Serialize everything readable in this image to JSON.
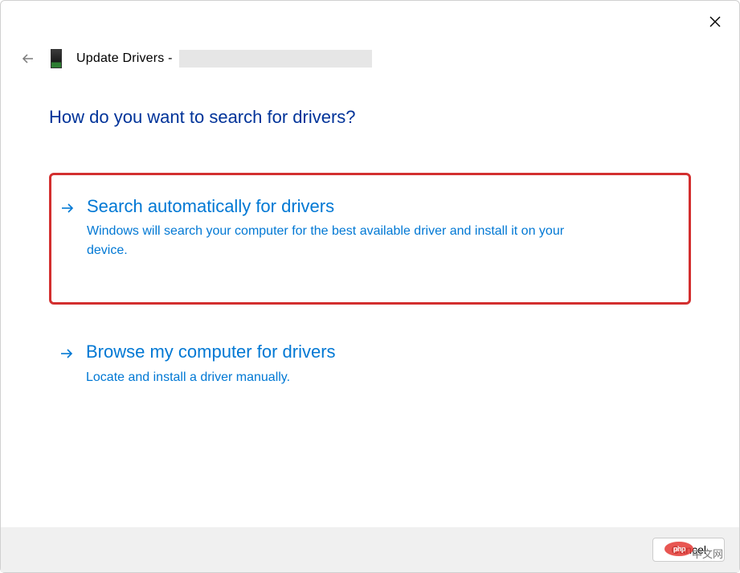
{
  "window": {
    "title_prefix": "Update Drivers -"
  },
  "header": {
    "question": "How do you want to search for drivers?"
  },
  "options": [
    {
      "title": "Search automatically for drivers",
      "description": "Windows will search your computer for the best available driver and install it on your device."
    },
    {
      "title": "Browse my computer for drivers",
      "description": "Locate and install a driver manually."
    }
  ],
  "footer": {
    "cancel_label": "Cancel",
    "overlay_text": "php"
  },
  "watermark": "中文网",
  "icons": {
    "close": "close-icon",
    "back": "back-arrow-icon",
    "device": "device-icon",
    "arrow": "right-arrow-icon"
  }
}
